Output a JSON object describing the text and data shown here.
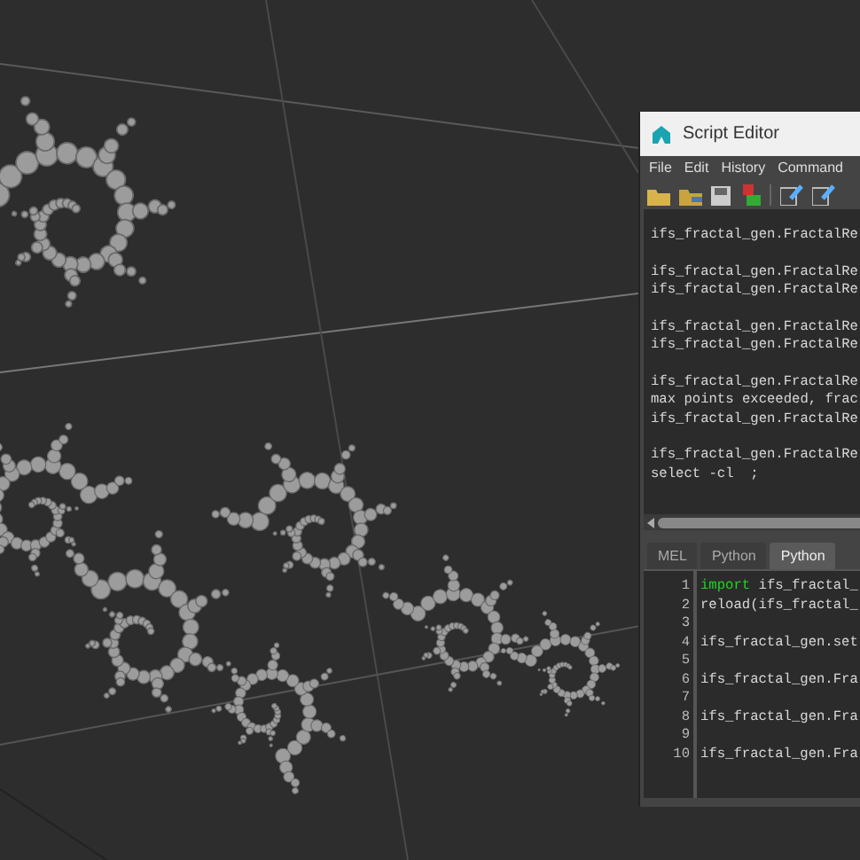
{
  "window": {
    "title": "Script Editor"
  },
  "menu": [
    "File",
    "Edit",
    "History",
    "Command"
  ],
  "history": [
    [
      "ifs_fractal_gen.FractalRe"
    ],
    [
      "ifs_fractal_gen.FractalRe",
      "ifs_fractal_gen.FractalRe"
    ],
    [
      "ifs_fractal_gen.FractalRe",
      "ifs_fractal_gen.FractalRe"
    ],
    [
      "ifs_fractal_gen.FractalRe",
      "max points exceeded, frac",
      "ifs_fractal_gen.FractalRe"
    ],
    [
      "ifs_fractal_gen.FractalRe",
      "select -cl  ;"
    ]
  ],
  "tabs": [
    {
      "label": "MEL",
      "selected": false
    },
    {
      "label": "Python",
      "selected": false
    },
    {
      "label": "Python",
      "selected": true
    }
  ],
  "code": [
    {
      "number": "1",
      "keyword": "import",
      "text": "ifs_fractal_"
    },
    {
      "number": "2",
      "text": "reload(ifs_fractal_"
    },
    {
      "number": "3"
    },
    {
      "number": "4",
      "text": "ifs_fractal_gen.set"
    },
    {
      "number": "5"
    },
    {
      "number": "6",
      "text": "ifs_fractal_gen.Fra"
    },
    {
      "number": "7"
    },
    {
      "number": "8",
      "text": "ifs_fractal_gen.Fra"
    },
    {
      "number": "9"
    },
    {
      "number": "10",
      "text": "ifs_fractal_gen.Fra"
    }
  ]
}
